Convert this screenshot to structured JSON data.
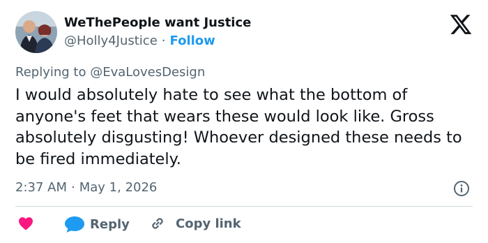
{
  "author": {
    "display_name": "WeThePeople want Justice",
    "handle": "@Holly4Justice",
    "separator": "·",
    "follow_label": "Follow"
  },
  "reply_context": {
    "prefix": "Replying to ",
    "mention": "@EvaLovesDesign"
  },
  "tweet": {
    "text": "I would absolutely hate to see what the bottom of anyone's feet that wears these would look like. Gross absolutely disgusting! Whoever designed these needs to be fired immediately.",
    "time": "2:37 AM",
    "separator": "·",
    "date": "May 1, 2026"
  },
  "actions": {
    "reply_label": "Reply",
    "copy_link_label": "Copy link"
  },
  "icons": {
    "brand": "x-logo-icon",
    "info": "info-icon",
    "like": "heart-icon",
    "reply": "reply-bubble-icon",
    "copy": "link-icon"
  },
  "colors": {
    "accent": "#1d9bf0",
    "like": "#f91880",
    "text_primary": "#0f1419",
    "text_secondary": "#536471",
    "divider": "#cfd9de"
  }
}
